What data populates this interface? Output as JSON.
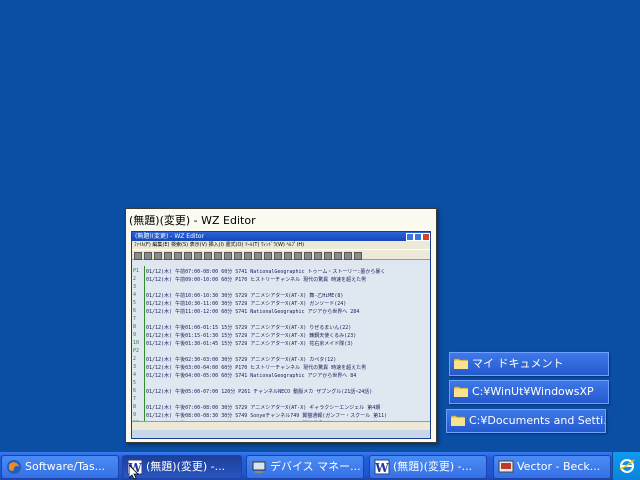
{
  "preview": {
    "title": "(無題)(変更) - WZ Editor",
    "editor_title": "(無題)(変更) - WZ Editor",
    "menu": "ﾌｧｲﾙ(F)  編集(E)  検索(S)  表示(V)  挿入(I)  書式(O)  ﾂｰﾙ(T)  ｳｨﾝﾄﾞｳ(W)  ﾍﾙﾌﾟ(H)",
    "lines": [
      {
        "g": "P1",
        "t": "01/12(木) 午前07:00-08:00 60分  S741 NationalGeographic  トゥーム・ストーリー:墓から暴く"
      },
      {
        "g": "2",
        "t": "01/12(木) 午前09:00-10:00 60分  P170 ヒストリーチャンネル  現代の驚異 時速を超えた男"
      },
      {
        "g": "3",
        "t": ""
      },
      {
        "g": "4",
        "t": "01/12(木) 午前10:00-10:30 30分  S729 アニメシアターX(AT-X)  舞-乙HiME(8)"
      },
      {
        "g": "5",
        "t": "01/12(木) 午前10:30-11:00 30分  S729 アニメシアターX(AT-X)  ガンソード(24)"
      },
      {
        "g": "6",
        "t": "01/12(木) 午前11:00-12:00 60分  S741 NationalGeographic  アジアから世界へ 284"
      },
      {
        "g": "7",
        "t": ""
      },
      {
        "g": "8",
        "t": "01/12(木) 午後01:00-01:15 15分  S729 アニメシアターX(AT-X)  りぜるまいん(22)"
      },
      {
        "g": "9",
        "t": "01/12(木) 午後01:15-01:30 15分  S729 アニメシアターX(AT-X)  錬鋼天使くるみ(23)"
      },
      {
        "g": "10",
        "t": "01/12(木) 午後01:30-01:45 15分  S729 アニメシアターX(AT-X)  花右京メイド隊(3)"
      },
      {
        "g": "P2",
        "t": ""
      },
      {
        "g": "2",
        "t": "01/12(木) 午後02:30-03:00 30分  S729 アニメシアターX(AT-X)  カペタ(12)"
      },
      {
        "g": "3",
        "t": "01/12(木) 午後03:00-04:00 60分  P170 ヒストリーチャンネル  現代の驚異 時速を超えた男"
      },
      {
        "g": "4",
        "t": "01/12(木) 午後04:00-05:00 60分  S741 NationalGeographic  アジアから世界へ 84"
      },
      {
        "g": "5",
        "t": ""
      },
      {
        "g": "6",
        "t": "01/12(木) 午後05:00-07:00 120分  P261 チャンネルNECO  動脈メカ ザブングル(21話~24話)"
      },
      {
        "g": "7",
        "t": ""
      },
      {
        "g": "8",
        "t": "01/12(木) 午後07:00-08:00 30分  S729 アニメシアターX(AT-X)  ギャラクシーエンジェル 第4期"
      },
      {
        "g": "9",
        "t": "01/12(木) 午後08:00-08:30 30分  S749 Sonyeチャンネル749  翼猫通報(ガンフー・スクール 第11)"
      },
      {
        "g": "10",
        "t": "01/12(木) 午後08:30-10:00 30分  S749 Sonyeチャンネル749  翼猫通報(ガンフー・スクール 第12)"
      }
    ]
  },
  "folders": [
    {
      "label": "マイ ドキュメント"
    },
    {
      "label": "C:¥WinUt¥WindowsXP"
    },
    {
      "label": "C:¥Documents and Setti..."
    }
  ],
  "taskbar": {
    "buttons": [
      {
        "label": "Software/Tas...",
        "icon": "firefox-icon"
      },
      {
        "label": "(無題)(変更) -...",
        "icon": "wz-editor-icon"
      },
      {
        "label": "デバイス マネー...",
        "icon": "device-manager-icon"
      },
      {
        "label": "(無題)(変更) -...",
        "icon": "wz-editor-icon"
      },
      {
        "label": "Vector - Beck...",
        "icon": "vector-icon"
      }
    ]
  },
  "colors": {
    "desktop": "#0b4fa5",
    "taskbar": "#245edb",
    "band": "#2f67dc"
  }
}
